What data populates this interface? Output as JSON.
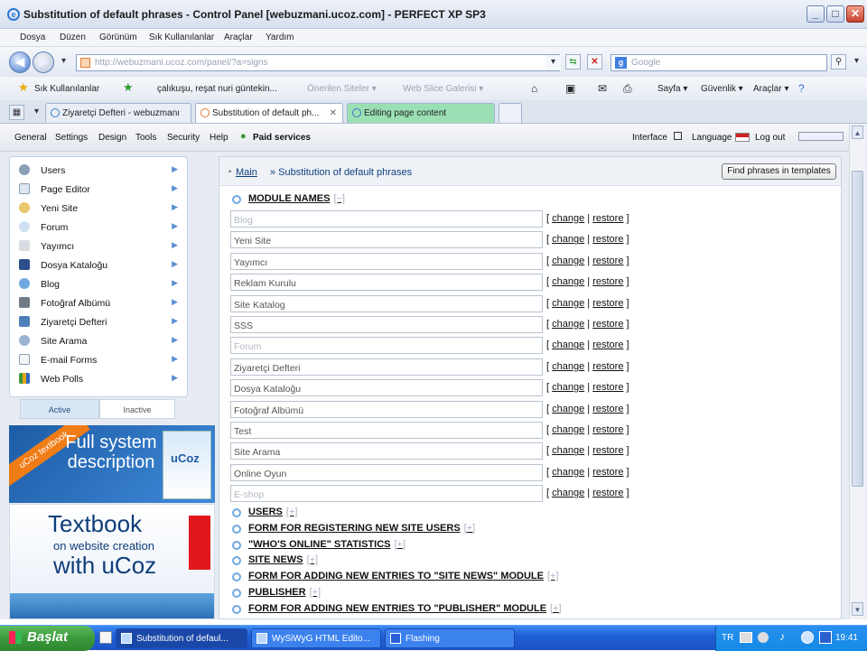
{
  "window": {
    "title": "Substitution of default phrases - Control Panel [webuzmani.ucoz.com] - PERFECT XP SP3",
    "buttons": {
      "minimize": "_",
      "maximize": "□",
      "close": "✕"
    }
  },
  "menubar": [
    "Dosya",
    "Düzen",
    "Görünüm",
    "Sık Kullanılanlar",
    "Araçlar",
    "Yardım"
  ],
  "address": {
    "url": "http://webuzmani.ucoz.com/panel/?a=signs",
    "search_placeholder": "Google"
  },
  "favorites": {
    "label": "Sık Kullanılanlar",
    "items": [
      "çalıkuşu, reşat nuri güntekin...",
      "Önerilen Siteler ▾",
      "Web Slice Galerisi ▾"
    ],
    "right": [
      "Sayfa ▾",
      "Güvenlik ▾",
      "Araçlar ▾"
    ]
  },
  "tabs": [
    {
      "label": "Ziyaretçi Defteri - webuzmanı"
    },
    {
      "label": "Substitution of default ph...",
      "close": "✕"
    },
    {
      "label": "Editing page content"
    }
  ],
  "topnav": {
    "items": [
      "General",
      "Settings",
      "Design",
      "Tools",
      "Security",
      "Help"
    ],
    "paid": "Paid services",
    "interface": "Interface",
    "language": "Language",
    "logout": "Log out"
  },
  "sidebar": {
    "items": [
      "Users",
      "Page Editor",
      "Yeni Site",
      "Forum",
      "Yayımcı",
      "Dosya Kataloğu",
      "Blog",
      "Fotoğraf Albümü",
      "Ziyaretçi Defteri",
      "Site Arama",
      "E-mail Forms",
      "Web Polls"
    ],
    "tab_active": "Active",
    "tab_inactive": "Inactive"
  },
  "banners": {
    "b1_ribbon": "uCoz textbook",
    "b1_text": "Full system description",
    "b1_book": "uCoz",
    "b2_l1": "Textbook",
    "b2_l2": "on website creation",
    "b2_l3": "with uCoz"
  },
  "main": {
    "crumb_main": "Main",
    "crumb_current": "» Substitution of default phrases",
    "find_button": "Find phrases in templates",
    "module_names_heading": "MODULE NAMES",
    "module_toggle": "[−]",
    "change": "change",
    "restore": "restore",
    "rows": [
      {
        "value": "Blog",
        "placeholder": true
      },
      {
        "value": "Yeni Site",
        "placeholder": false
      },
      {
        "value": "Yayımcı",
        "placeholder": false
      },
      {
        "value": "Reklam Kurulu",
        "placeholder": false
      },
      {
        "value": "Site Katalog",
        "placeholder": false
      },
      {
        "value": "SSS",
        "placeholder": false
      },
      {
        "value": "Forum",
        "placeholder": true
      },
      {
        "value": "Ziyaretçi Defteri",
        "placeholder": false
      },
      {
        "value": "Dosya Kataloğu",
        "placeholder": false
      },
      {
        "value": "Fotoğraf Albümü",
        "placeholder": false
      },
      {
        "value": "Test",
        "placeholder": false
      },
      {
        "value": "Site Arama",
        "placeholder": false
      },
      {
        "value": "Online Oyun",
        "placeholder": false
      },
      {
        "value": "E-shop",
        "placeholder": true
      }
    ],
    "sections": [
      "USERS",
      "FORM FOR REGISTERING NEW SITE USERS",
      "\"WHO'S ONLINE\" STATISTICS",
      "SITE NEWS",
      "FORM FOR ADDING NEW ENTRIES TO \"SITE NEWS\" MODULE",
      "PUBLISHER",
      "FORM FOR ADDING NEW ENTRIES TO \"PUBLISHER\" MODULE"
    ],
    "expand_toggle": "[+]"
  },
  "taskbar": {
    "start": "Başlat",
    "items": [
      "Substitution of defaul...",
      "WySiWyG HTML Edito...",
      "Flashing"
    ],
    "lang": "TR",
    "clock": "19:41"
  }
}
